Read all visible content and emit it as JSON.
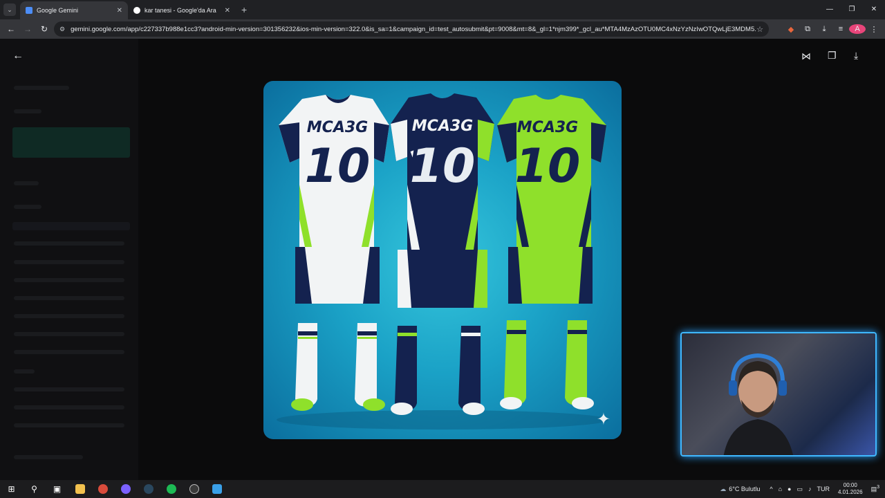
{
  "tabs": [
    {
      "title": "Google Gemini",
      "favicon_color": "#4c8df6",
      "active": true
    },
    {
      "title": "kar tanesi - Google'da Ara",
      "favicon_color": "#ffffff",
      "active": false
    }
  ],
  "omnibox": {
    "url": "gemini.google.com/app/c227337b988e1cc3?android-min-version=301356232&ios-min-version=322.0&is_sa=1&campaign_id=test_autosubmit&pt=9008&mt=8&_gl=1*njm399*_gcl_au*MTA4MzAzOTU0MC4xNzYzNzIwOTQwLjE3MDM5..."
  },
  "profile": {
    "initial": "A"
  },
  "viewer": {
    "image_kit_text": "MCA3G",
    "image_number": "10"
  },
  "taskbar": {
    "weather": "6°C Bulutlu",
    "language": "TUR",
    "time": "00:00",
    "date": "4.01.2026",
    "notification_count": "3"
  },
  "colors": {
    "kit_navy": "#14224f",
    "kit_lime": "#8fe02b",
    "kit_white": "#f2f4f5",
    "webcam_border": "#3fb8ff"
  }
}
